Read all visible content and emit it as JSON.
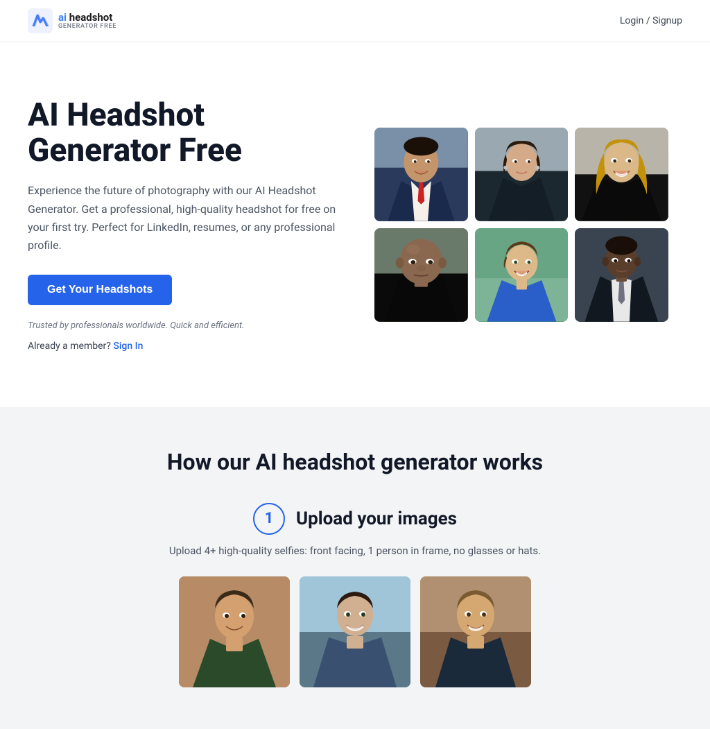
{
  "header": {
    "logo_name_part1": "ai",
    "logo_name_part2": " headshot",
    "logo_subtitle": "GENERATOR FREE",
    "nav_auth_label": "Login / Signup"
  },
  "hero": {
    "title": "AI Headshot Generator Free",
    "description": "Experience the future of photography with our AI Headshot Generator. Get a professional, high-quality headshot for free on your first try. Perfect for LinkedIn, resumes, or any professional profile.",
    "cta_button_label": "Get Your Headshots",
    "trust_text": "Trusted by professionals worldwide. Quick and efficient.",
    "signin_prompt": "Already a member?",
    "signin_link": "Sign In"
  },
  "headshots": {
    "images": [
      {
        "id": "person1",
        "alt": "Professional man in blue suit"
      },
      {
        "id": "person2",
        "alt": "Professional woman dark jacket"
      },
      {
        "id": "person3",
        "alt": "Woman with long hair smiling"
      },
      {
        "id": "person4",
        "alt": "Bald man serious expression"
      },
      {
        "id": "person5",
        "alt": "Young man smiling outdoors"
      },
      {
        "id": "person6",
        "alt": "Black man in dark suit"
      }
    ]
  },
  "how_it_works": {
    "title": "How our AI headshot generator works",
    "step1": {
      "number": "1",
      "label": "Upload your images",
      "description": "Upload 4+ high-quality selfies: front facing, 1 person in frame, no glasses or hats."
    }
  },
  "icons": {
    "logo_chevron": "❯"
  }
}
